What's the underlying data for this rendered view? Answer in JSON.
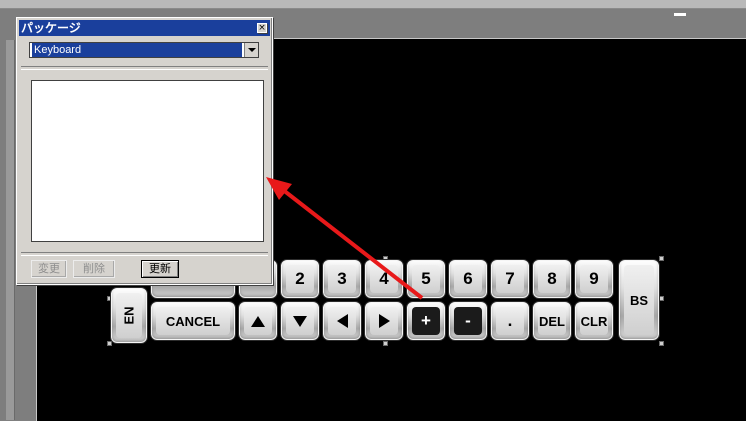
{
  "dialog": {
    "title": "パッケージ",
    "close_glyph": "×",
    "combo_value": "Keyboard",
    "buttons": {
      "change": "変更",
      "delete": "削除",
      "update": "更新"
    }
  },
  "keyboard": {
    "number_keys": [
      "2",
      "3",
      "4",
      "5",
      "6",
      "7",
      "8",
      "9"
    ],
    "ent_label": "EN",
    "cancel_label": "CANCEL",
    "plus_label": "+",
    "minus_label": "-",
    "dot_label": ".",
    "del_label": "DEL",
    "clr_label": "CLR",
    "bs_label": "BS"
  },
  "annotation": {
    "arrow_color": "#e8191a"
  },
  "colors": {
    "titlebar": "#1a3f9c",
    "canvas": "#000000"
  }
}
